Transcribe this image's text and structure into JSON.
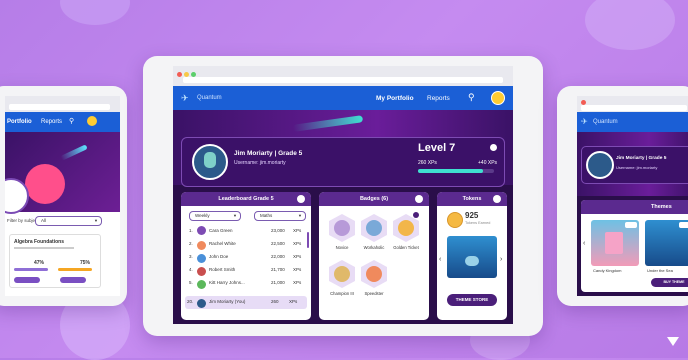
{
  "colors": {
    "background": "#b67de8",
    "nav_blue": "#1b5fd6",
    "purple_dark": "#2a0e4a",
    "accent_teal": "#3fe0d0"
  },
  "center": {
    "app_name": "Quantum",
    "nav": {
      "portfolio": "My Portfolio",
      "reports": "Reports",
      "search_icon": "search-icon"
    },
    "profile": {
      "name_line": "Jim Moriarty | Grade 5",
      "username": "Username: jim.moriarty",
      "level": "Level 7",
      "xps": "260 XPs",
      "next_xps": "+40 XPs",
      "progress": 0.85
    },
    "leaderboard": {
      "title": "Leaderboard Grade 5",
      "filter_period": "Weekly",
      "filter_subject": "Maths",
      "rows": [
        {
          "rank": "1.",
          "name": "Cara Green",
          "xp": "23,000",
          "unit": "XPs"
        },
        {
          "rank": "2.",
          "name": "Rachel White",
          "xp": "22,500",
          "unit": "XPs"
        },
        {
          "rank": "3.",
          "name": "John Doe",
          "xp": "22,000",
          "unit": "XPs"
        },
        {
          "rank": "4.",
          "name": "Robert Smith",
          "xp": "21,700",
          "unit": "XPs"
        },
        {
          "rank": "5.",
          "name": "Kitt Harry Johns...",
          "xp": "21,000",
          "unit": "XPs"
        },
        {
          "rank": "20.",
          "name": "Jim Moriarty (You)",
          "xp": "260",
          "unit": "XPs"
        }
      ]
    },
    "badges": {
      "title": "Badges (6)",
      "items": [
        {
          "label": "Novice"
        },
        {
          "label": "Workaholic"
        },
        {
          "label": "Golden Ticket"
        },
        {
          "label": "Champion III"
        },
        {
          "label": "Speedster"
        }
      ]
    },
    "tokens": {
      "title": "Tokens",
      "count": "925",
      "caption": "Tokens Earned",
      "store_button": "THEME STORE"
    }
  },
  "left": {
    "nav": {
      "portfolio": "Portfolio",
      "reports": "Reports"
    },
    "filter_label": "Filter by subject:",
    "filter_value": "All",
    "card_title": "Algebra Foundations",
    "stat1": "47%",
    "stat2": "75%"
  },
  "right": {
    "app_name": "Quantum",
    "profile_name": "Jim Moriarty | Grade 5",
    "username": "Username: jim.moriarty",
    "themes_title": "Themes",
    "theme1": "Candy Kingdom",
    "theme2": "Under the Sea",
    "buy_button": "BUY THEME"
  }
}
